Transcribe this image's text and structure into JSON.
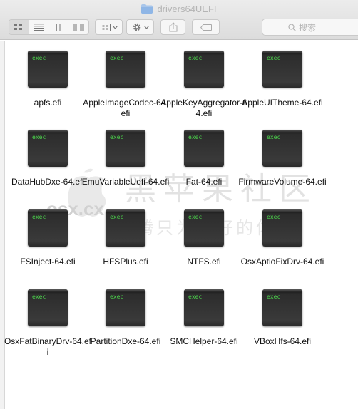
{
  "window": {
    "title": "drivers64UEFI"
  },
  "toolbar": {
    "view_modes": [
      "icon-view",
      "list-view",
      "column-view",
      "cover-flow-view"
    ],
    "arrange_icon": "grid-arrange-icon",
    "action_icon": "gear-icon",
    "share_icon": "share-icon",
    "tag_icon": "tag-icon",
    "search_placeholder": "搜索"
  },
  "files": [
    {
      "name": "apfs.efi",
      "badge": "exec"
    },
    {
      "name": "AppleImageCodec-64.efi",
      "badge": "exec"
    },
    {
      "name": "AppleKeyAggregator-64.efi",
      "badge": "exec"
    },
    {
      "name": "AppleUITheme-64.efi",
      "badge": "exec"
    },
    {
      "name": "DataHubDxe-64.efi",
      "badge": "exec"
    },
    {
      "name": "EmuVariableUefi-64.efi",
      "badge": "exec"
    },
    {
      "name": "Fat-64.efi",
      "badge": "exec"
    },
    {
      "name": "FirmwareVolume-64.efi",
      "badge": "exec"
    },
    {
      "name": "FSInject-64.efi",
      "badge": "exec"
    },
    {
      "name": "HFSPlus.efi",
      "badge": "exec"
    },
    {
      "name": "NTFS.efi",
      "badge": "exec"
    },
    {
      "name": "OsxAptioFixDrv-64.efi",
      "badge": "exec"
    },
    {
      "name": "OsxFatBinaryDrv-64.efi",
      "badge": "exec"
    },
    {
      "name": "PartitionDxe-64.efi",
      "badge": "exec"
    },
    {
      "name": "SMCHelper-64.efi",
      "badge": "exec"
    },
    {
      "name": "VBoxHfs-64.efi",
      "badge": "exec"
    }
  ],
  "watermark": {
    "site": "osx.cx",
    "title": "黑苹果社区",
    "slogan": "折腾只为更好的体验"
  }
}
